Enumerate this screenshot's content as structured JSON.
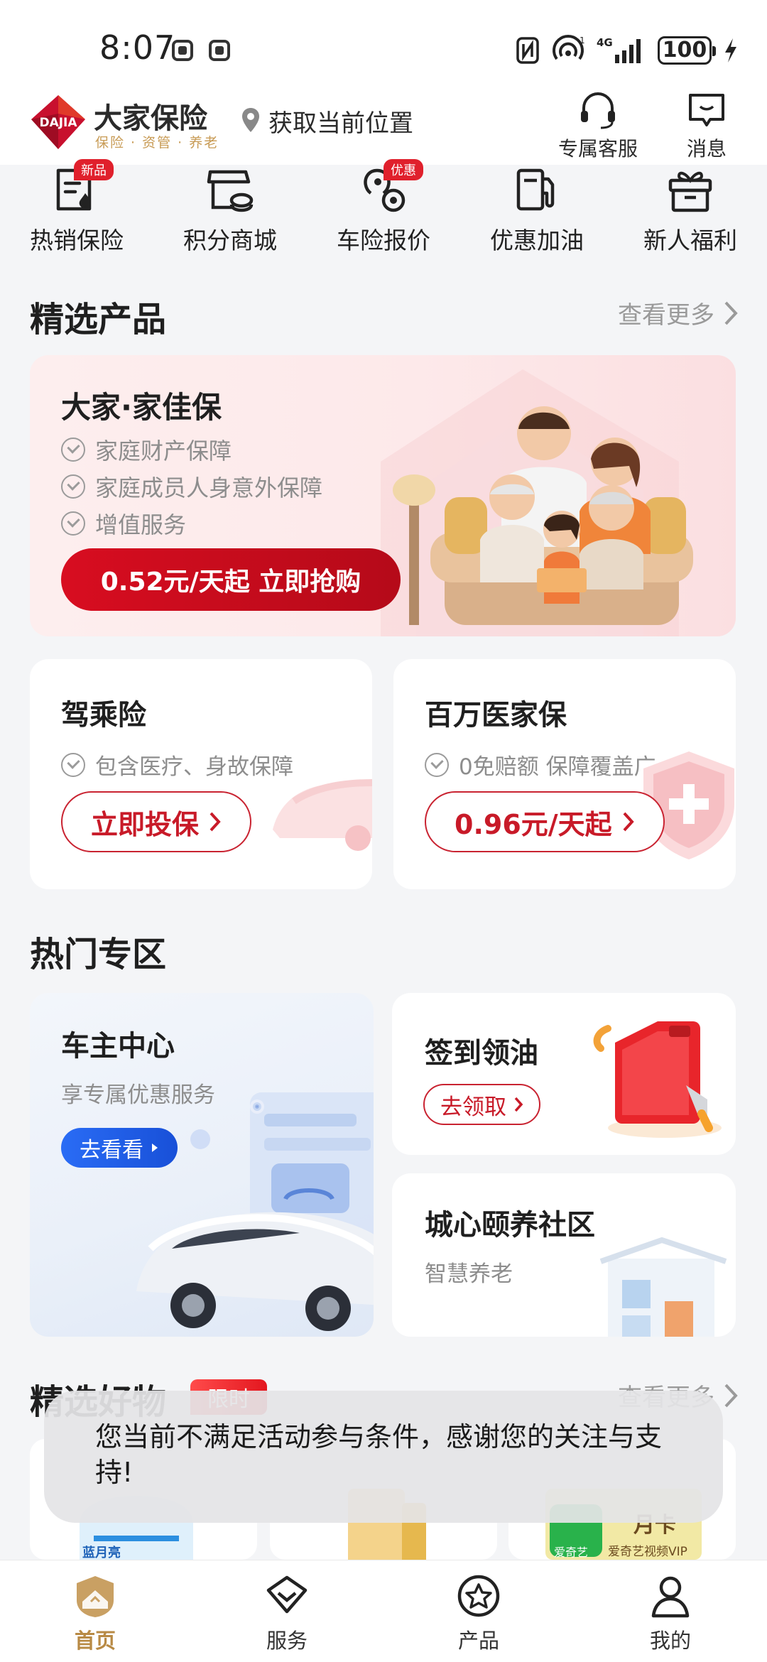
{
  "status_bar": {
    "time": "8:07",
    "battery": "100"
  },
  "header": {
    "brand_name": "大家保险",
    "brand_tagline": "保险 · 资管 · 养老",
    "logo_text": "DAJIA",
    "location": "获取当前位置",
    "service_label": "专属客服",
    "message_label": "消息"
  },
  "quick_menu": [
    {
      "label": "热销保险",
      "icon": "hot-insurance-icon",
      "badge": "新品"
    },
    {
      "label": "积分商城",
      "icon": "points-mall-icon",
      "badge": ""
    },
    {
      "label": "车险报价",
      "icon": "car-quote-icon",
      "badge": "优惠"
    },
    {
      "label": "优惠加油",
      "icon": "fuel-icon",
      "badge": ""
    },
    {
      "label": "新人福利",
      "icon": "gift-icon",
      "badge": ""
    }
  ],
  "featured": {
    "title": "精选产品",
    "see_more": "查看更多",
    "main": {
      "name": "大家·家佳保",
      "features": [
        "家庭财产保障",
        "家庭成员人身意外保障",
        "增值服务"
      ],
      "cta": "0.52元/天起 立即抢购"
    },
    "cards": [
      {
        "name": "驾乘险",
        "feature": "包含医疗、身故保障",
        "cta": "立即投保"
      },
      {
        "name": "百万医家保",
        "feature": "0免赔额 保障覆盖广",
        "cta": "0.96元/天起"
      }
    ]
  },
  "hot_zone": {
    "title": "热门专区",
    "owner_center": {
      "title": "车主中心",
      "subtitle": "享专属优惠服务",
      "cta": "去看看"
    },
    "oil_checkin": {
      "title": "签到领油",
      "cta": "去领取"
    },
    "community": {
      "title": "城心颐养社区",
      "subtitle": "智慧养老"
    }
  },
  "goods": {
    "title": "精选好物",
    "badge": "限时",
    "see_more": "查看更多",
    "items": [
      {
        "label": "蓝月亮"
      },
      {
        "label": ""
      },
      {
        "label": "爱奇艺",
        "sub": "月卡",
        "note": "爱奇艺视频VIP"
      }
    ]
  },
  "toast": {
    "message": "您当前不满足活动参与条件，感谢您的关注与支持!"
  },
  "bottom_nav": [
    {
      "label": "首页",
      "icon": "home-icon",
      "active": true
    },
    {
      "label": "服务",
      "icon": "service-icon",
      "active": false
    },
    {
      "label": "产品",
      "icon": "product-icon",
      "active": false
    },
    {
      "label": "我的",
      "icon": "profile-icon",
      "active": false
    }
  ],
  "colors": {
    "brand_red": "#d80d20",
    "gold": "#b88a45",
    "blue": "#1850d8"
  }
}
